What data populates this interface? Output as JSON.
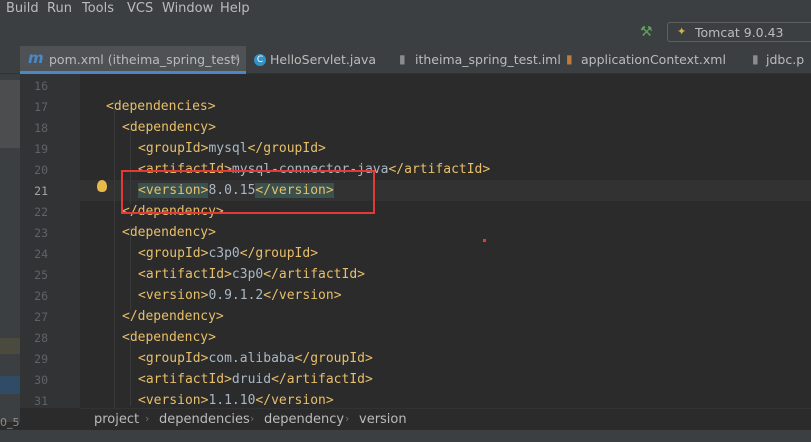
{
  "menu": {
    "items": [
      {
        "label": "Build"
      },
      {
        "label": "Run"
      },
      {
        "label": "Tools"
      },
      {
        "label": "VCS"
      },
      {
        "label": "Window"
      },
      {
        "label": "Help"
      }
    ]
  },
  "toolbar": {
    "build_icon": "hammer-icon",
    "run_config": "Tomcat 9.0.43"
  },
  "tabs": [
    {
      "label": "pom.xml (itheima_spring_test)",
      "icon": "maven-icon",
      "active": true
    },
    {
      "label": "HelloServlet.java",
      "icon": "class-icon"
    },
    {
      "label": "itheima_spring_test.iml",
      "icon": "module-file-icon"
    },
    {
      "label": "applicationContext.xml",
      "icon": "xml-file-icon"
    },
    {
      "label": "jdbc.p",
      "icon": "properties-file-icon"
    }
  ],
  "editor": {
    "current_line": 21,
    "lines": [
      {
        "num": "16",
        "parts": []
      },
      {
        "num": "17",
        "parts": [
          {
            "tag": "<dependencies>"
          }
        ]
      },
      {
        "num": "18",
        "parts": [
          {
            "tag": "<dependency>"
          }
        ]
      },
      {
        "num": "19",
        "parts": [
          {
            "tag": "<groupId>"
          },
          {
            "text": "mysql"
          },
          {
            "tag": "</groupId>"
          }
        ]
      },
      {
        "num": "20",
        "parts": [
          {
            "tag": "<artifactId>"
          },
          {
            "text": "mysql-connector-java"
          },
          {
            "tag": "</artifactId>"
          }
        ]
      },
      {
        "num": "21",
        "parts": [
          {
            "tag": "<version>"
          },
          {
            "text": "8.0.15"
          },
          {
            "tag": "</version>"
          }
        ]
      },
      {
        "num": "22",
        "parts": [
          {
            "tag": "</dependency>"
          }
        ]
      },
      {
        "num": "23",
        "parts": [
          {
            "tag": "<dependency>"
          }
        ]
      },
      {
        "num": "24",
        "parts": [
          {
            "tag": "<groupId>"
          },
          {
            "text": "c3p0"
          },
          {
            "tag": "</groupId>"
          }
        ]
      },
      {
        "num": "25",
        "parts": [
          {
            "tag": "<artifactId>"
          },
          {
            "text": "c3p0"
          },
          {
            "tag": "</artifactId>"
          }
        ]
      },
      {
        "num": "26",
        "parts": [
          {
            "tag": "<version>"
          },
          {
            "text": "0.9.1.2"
          },
          {
            "tag": "</version>"
          }
        ]
      },
      {
        "num": "27",
        "parts": [
          {
            "tag": "</dependency>"
          }
        ]
      },
      {
        "num": "28",
        "parts": [
          {
            "tag": "<dependency>"
          }
        ]
      },
      {
        "num": "29",
        "parts": [
          {
            "tag": "<groupId>"
          },
          {
            "text": "com.alibaba"
          },
          {
            "tag": "</groupId>"
          }
        ]
      },
      {
        "num": "30",
        "parts": [
          {
            "tag": "<artifactId>"
          },
          {
            "text": "druid"
          },
          {
            "tag": "</artifactId>"
          }
        ]
      },
      {
        "num": "31",
        "parts": [
          {
            "tag": "<version>"
          },
          {
            "text": "1.1.10"
          },
          {
            "tag": "</version>"
          }
        ]
      }
    ]
  },
  "breadcrumb": [
    {
      "label": "project"
    },
    {
      "label": "dependencies"
    },
    {
      "label": "dependency"
    },
    {
      "label": "version"
    }
  ],
  "left_panel_text": "0_5",
  "colors": {
    "highlight_box": "#e53935",
    "tag": "#e8bf6a",
    "text": "#a9b7c6",
    "background": "#2b2b2b"
  }
}
